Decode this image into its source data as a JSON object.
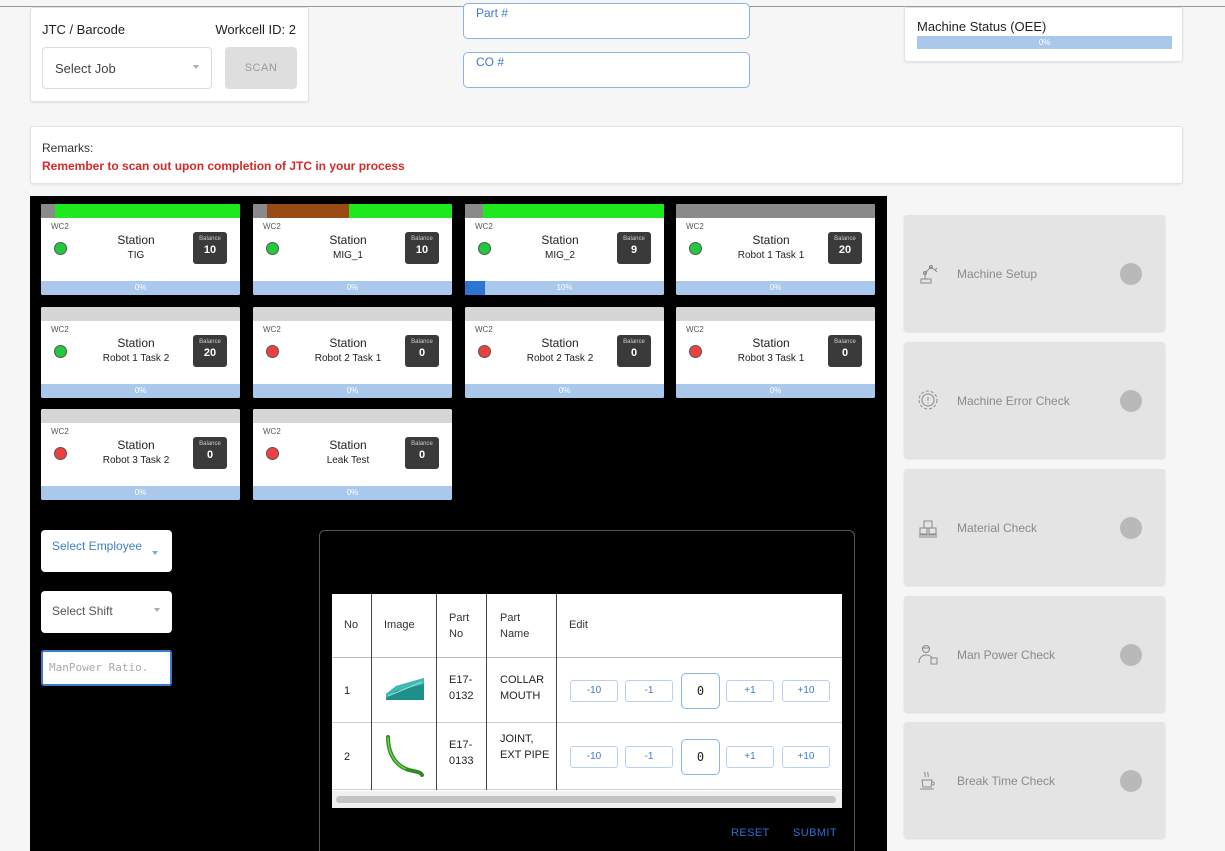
{
  "jtc": {
    "label": "JTC / Barcode",
    "workcell": "Workcell ID: 2",
    "select_job": "Select Job",
    "scan_label": "SCAN"
  },
  "inputs": {
    "part_placeholder": "Part #",
    "co_placeholder": "CO #"
  },
  "machine_status": {
    "title": "Machine Status (OEE)",
    "value": "0%",
    "fill_fraction": 0
  },
  "remarks": {
    "label": "Remarks:",
    "text": "Remember to scan out upon completion of JTC in your process"
  },
  "colors": {
    "status_green": "#22c93d",
    "status_red": "#ef4040",
    "bar_green": "#1ee81e",
    "bar_brown": "#9a4a14",
    "bar_gray": "#8a8a8a",
    "progress_bg": "#a9c8ec",
    "progress_fill": "#2c75d4",
    "remark_red": "#d42a2a"
  },
  "stations": [
    {
      "wc": "WC2",
      "title": "Station",
      "name": "TIG",
      "balance_label": "Balance",
      "balance": "10",
      "status": "green",
      "progress": "0%",
      "progress_fraction": 0,
      "bar": [
        "gray",
        "green"
      ]
    },
    {
      "wc": "WC2",
      "title": "Station",
      "name": "MIG_1",
      "balance_label": "Balance",
      "balance": "10",
      "status": "green",
      "progress": "0%",
      "progress_fraction": 0,
      "bar": [
        "gray",
        "brown",
        "green"
      ]
    },
    {
      "wc": "WC2",
      "title": "Station",
      "name": "MIG_2",
      "balance_label": "Balance",
      "balance": "9",
      "status": "green",
      "progress": "10%",
      "progress_fraction": 0.1,
      "bar": [
        "gray",
        "green"
      ]
    },
    {
      "wc": "WC2",
      "title": "Station",
      "name": "Robot 1 Task 1",
      "balance_label": "Balance",
      "balance": "20",
      "status": "green",
      "progress": "0%",
      "progress_fraction": 0,
      "bar": [
        "gray"
      ]
    },
    {
      "wc": "WC2",
      "title": "Station",
      "name": "Robot 1 Task 2",
      "balance_label": "Balance",
      "balance": "20",
      "status": "green",
      "progress": "0%",
      "progress_fraction": 0,
      "bar": []
    },
    {
      "wc": "WC2",
      "title": "Station",
      "name": "Robot 2 Task 1",
      "balance_label": "Balance",
      "balance": "0",
      "status": "red",
      "progress": "0%",
      "progress_fraction": 0,
      "bar": []
    },
    {
      "wc": "WC2",
      "title": "Station",
      "name": "Robot 2 Task 2",
      "balance_label": "Balance",
      "balance": "0",
      "status": "red",
      "progress": "0%",
      "progress_fraction": 0,
      "bar": []
    },
    {
      "wc": "WC2",
      "title": "Station",
      "name": "Robot 3 Task 1",
      "balance_label": "Balance",
      "balance": "0",
      "status": "red",
      "progress": "0%",
      "progress_fraction": 0,
      "bar": []
    },
    {
      "wc": "WC2",
      "title": "Station",
      "name": "Robot 3 Task 2",
      "balance_label": "Balance",
      "balance": "0",
      "status": "red",
      "progress": "0%",
      "progress_fraction": 0,
      "bar": []
    },
    {
      "wc": "WC2",
      "title": "Station",
      "name": "Leak Test",
      "balance_label": "Balance",
      "balance": "0",
      "status": "red",
      "progress": "0%",
      "progress_fraction": 0,
      "bar": []
    }
  ],
  "controls": {
    "select_employee": "Select Employee",
    "select_shift": "Select Shift",
    "manpower_placeholder": "ManPower Ratio."
  },
  "table": {
    "headers": {
      "no": "No",
      "image": "Image",
      "part_no": "Part No",
      "part_name": "Part Name",
      "edit": "Edit"
    },
    "rows": [
      {
        "no": "1",
        "image_icon": "collar-mouth-part-icon",
        "part_no": "E17-0132",
        "part_name": "COLLAR MOUTH",
        "qty": "0"
      },
      {
        "no": "2",
        "image_icon": "joint-pipe-part-icon",
        "part_no": "E17-0133",
        "part_name": "JOINT, EXT PIPE",
        "qty": "0"
      }
    ],
    "steps": [
      "-10",
      "-1",
      "+1",
      "+10"
    ],
    "reset": "RESET",
    "submit": "SUBMIT"
  },
  "checks": [
    {
      "label": "Machine Setup",
      "icon": "robot-arm-icon"
    },
    {
      "label": "Machine Error Check",
      "icon": "gear-error-icon"
    },
    {
      "label": "Material Check",
      "icon": "pallet-boxes-icon"
    },
    {
      "label": "Man Power Check",
      "icon": "worker-icon"
    },
    {
      "label": "Break Time Check",
      "icon": "coffee-cup-icon"
    }
  ]
}
